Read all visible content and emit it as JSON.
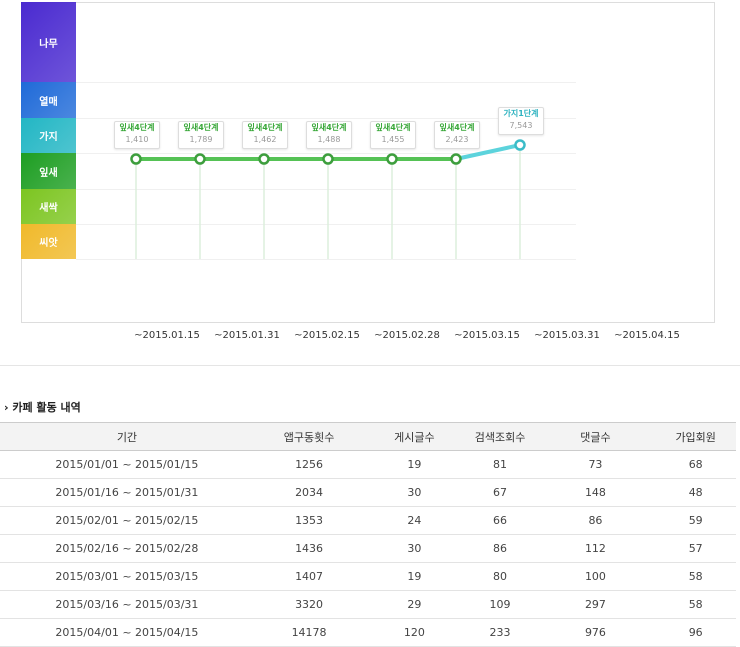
{
  "levels": [
    {
      "label": "나무",
      "color": "#4a2ad0"
    },
    {
      "label": "열매",
      "color": "#1f6ad8"
    },
    {
      "label": "가지",
      "color": "#22b6c4"
    },
    {
      "label": "잎새",
      "color": "#1d9e22"
    },
    {
      "label": "새싹",
      "color": "#7cc520"
    },
    {
      "label": "씨앗",
      "color": "#f0b92a"
    }
  ],
  "points": [
    {
      "level": "잎새4단계",
      "value": "1,410",
      "tier": "leaf"
    },
    {
      "level": "잎새4단계",
      "value": "1,789",
      "tier": "leaf"
    },
    {
      "level": "잎새4단계",
      "value": "1,462",
      "tier": "leaf"
    },
    {
      "level": "잎새4단계",
      "value": "1,488",
      "tier": "leaf"
    },
    {
      "level": "잎새4단계",
      "value": "1,455",
      "tier": "leaf"
    },
    {
      "level": "잎새4단계",
      "value": "2,423",
      "tier": "leaf"
    },
    {
      "level": "가지1단계",
      "value": "7,543",
      "tier": "branch"
    }
  ],
  "dates": [
    "~2015.01.15",
    "~2015.01.31",
    "~2015.02.15",
    "~2015.02.28",
    "~2015.03.15",
    "~2015.03.31",
    "~2015.04.15"
  ],
  "section_title": "카페 활동 내역",
  "table": {
    "headers": [
      "기간",
      "앱구동횟수",
      "게시글수",
      "검색조회수",
      "댓글수",
      "가입회원"
    ],
    "rows": [
      [
        "2015/01/01 ~ 2015/01/15",
        "1256",
        "19",
        "81",
        "73",
        "68"
      ],
      [
        "2015/01/16 ~ 2015/01/31",
        "2034",
        "30",
        "67",
        "148",
        "48"
      ],
      [
        "2015/02/01 ~ 2015/02/15",
        "1353",
        "24",
        "66",
        "86",
        "59"
      ],
      [
        "2015/02/16 ~ 2015/02/28",
        "1436",
        "30",
        "86",
        "112",
        "57"
      ],
      [
        "2015/03/01 ~ 2015/03/15",
        "1407",
        "19",
        "80",
        "100",
        "58"
      ],
      [
        "2015/03/16 ~ 2015/03/31",
        "3320",
        "29",
        "109",
        "297",
        "58"
      ],
      [
        "2015/04/01 ~ 2015/04/15",
        "14178",
        "120",
        "233",
        "976",
        "96"
      ]
    ]
  }
}
